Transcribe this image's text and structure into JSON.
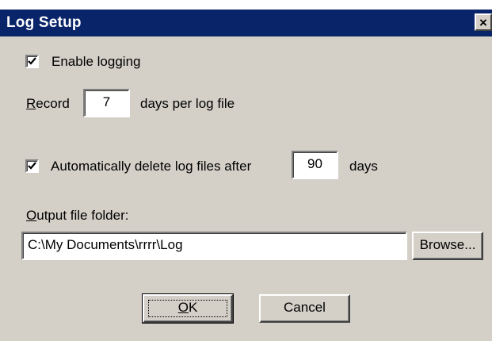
{
  "dialog": {
    "title": "Log Setup",
    "close_glyph": "×"
  },
  "enable_logging": {
    "label": "Enable logging",
    "checked": true
  },
  "record": {
    "label_prefix": "R",
    "label_rest": "ecord",
    "value": "7",
    "suffix": "days per log file"
  },
  "auto_delete": {
    "label": "Automatically delete log files after",
    "checked": true,
    "value": "90",
    "suffix": "days"
  },
  "output_folder": {
    "label_prefix": "O",
    "label_rest": "utput file folder:",
    "value": "C:\\My Documents\\rrrr\\Log",
    "browse_label": "Browse..."
  },
  "buttons": {
    "ok_prefix": "O",
    "ok_rest": "K",
    "cancel_label": "Cancel"
  },
  "colors": {
    "title_bar": "#0a246a",
    "face": "#d4d0c8"
  },
  "icons": {
    "close": "close-icon",
    "check": "checkmark-icon"
  }
}
